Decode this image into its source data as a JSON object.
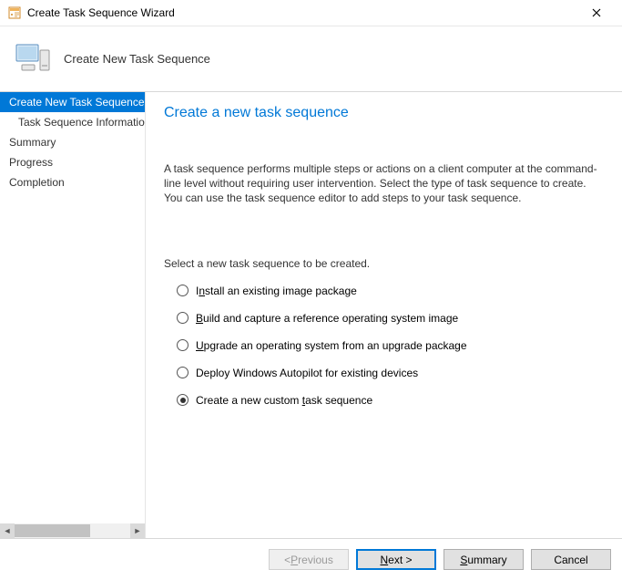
{
  "titlebar": {
    "title": "Create Task Sequence Wizard"
  },
  "header": {
    "title": "Create New Task Sequence"
  },
  "sidebar": {
    "items": [
      {
        "label": "Create New Task Sequence",
        "selected": true,
        "indented": false
      },
      {
        "label": "Task Sequence Information",
        "selected": false,
        "indented": true
      },
      {
        "label": "Summary",
        "selected": false,
        "indented": false
      },
      {
        "label": "Progress",
        "selected": false,
        "indented": false
      },
      {
        "label": "Completion",
        "selected": false,
        "indented": false
      }
    ]
  },
  "main": {
    "title": "Create a new task sequence",
    "description": "A task sequence performs multiple steps or actions on a client computer at the command-line level without requiring user intervention. Select the type of task sequence to create. You can use the task sequence editor to add steps to your task sequence.",
    "prompt": "Select a new task sequence to be created.",
    "options": [
      {
        "label_pre": "I",
        "label_mn": "n",
        "label_post": "stall an existing image package",
        "selected": false
      },
      {
        "label_pre": "",
        "label_mn": "B",
        "label_post": "uild and capture a reference operating system image",
        "selected": false
      },
      {
        "label_pre": "",
        "label_mn": "U",
        "label_post": "pgrade an operating system from an upgrade package",
        "selected": false
      },
      {
        "label_pre": "Deploy Windows Autopilot for existing devices",
        "label_mn": "",
        "label_post": "",
        "selected": false
      },
      {
        "label_pre": "Create a new custom ",
        "label_mn": "t",
        "label_post": "ask sequence",
        "selected": true
      }
    ]
  },
  "footer": {
    "previous_pre": "< ",
    "previous_mn": "P",
    "previous_post": "revious",
    "next_pre": "",
    "next_mn": "N",
    "next_post": "ext >",
    "summary_pre": "",
    "summary_mn": "S",
    "summary_post": "ummary",
    "cancel": "Cancel"
  }
}
